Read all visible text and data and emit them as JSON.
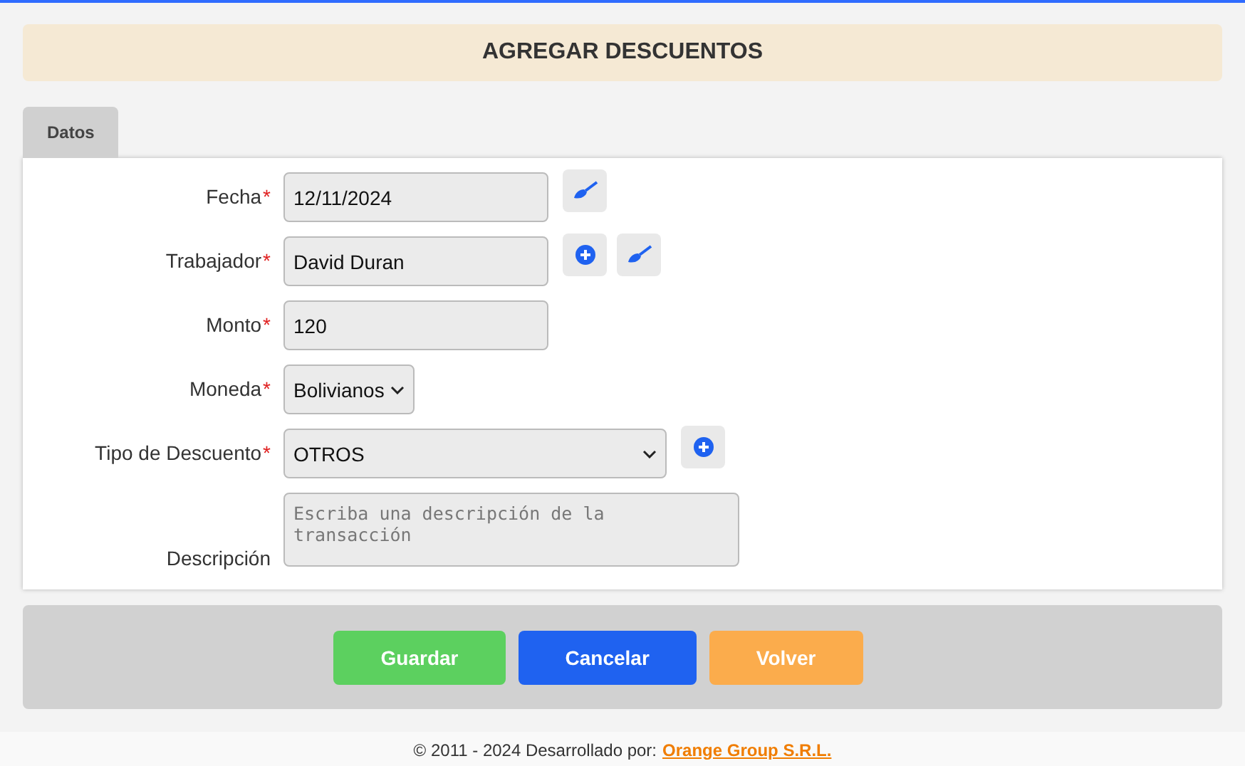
{
  "header": {
    "title": "AGREGAR DESCUENTOS"
  },
  "tabs": [
    {
      "label": "Datos",
      "selected": true
    }
  ],
  "fields": [
    {
      "kind": "text",
      "label": "Fecha",
      "required_mark": "*",
      "value": "12/11/2024",
      "actions": [
        {
          "kind": "clear"
        }
      ]
    },
    {
      "kind": "text",
      "label": "Trabajador",
      "required_mark": "*",
      "value": "David Duran",
      "actions": [
        {
          "kind": "add"
        },
        {
          "kind": "clear"
        }
      ]
    },
    {
      "kind": "text",
      "label": "Monto",
      "required_mark": "*",
      "value": "120"
    },
    {
      "kind": "select",
      "label": "Moneda",
      "required_mark": "*",
      "value": "Bolivianos"
    },
    {
      "kind": "dropdown",
      "label": "Tipo de Descuento",
      "required_mark": "*",
      "value": "OTROS",
      "actions": [
        {
          "kind": "add"
        }
      ]
    },
    {
      "kind": "textarea",
      "label": "Descripción",
      "placeholder": "Escriba una descripción de la transacción"
    }
  ],
  "buttons": [
    {
      "label": "Guardar",
      "color": "#5cd05f"
    },
    {
      "label": "Cancelar",
      "color": "#1f62f0"
    },
    {
      "label": "Volver",
      "color": "#fbac4c"
    }
  ],
  "footer": {
    "text": "© 2011 - 2024 Desarrollado por:",
    "link": "Orange Group S.R.L."
  }
}
